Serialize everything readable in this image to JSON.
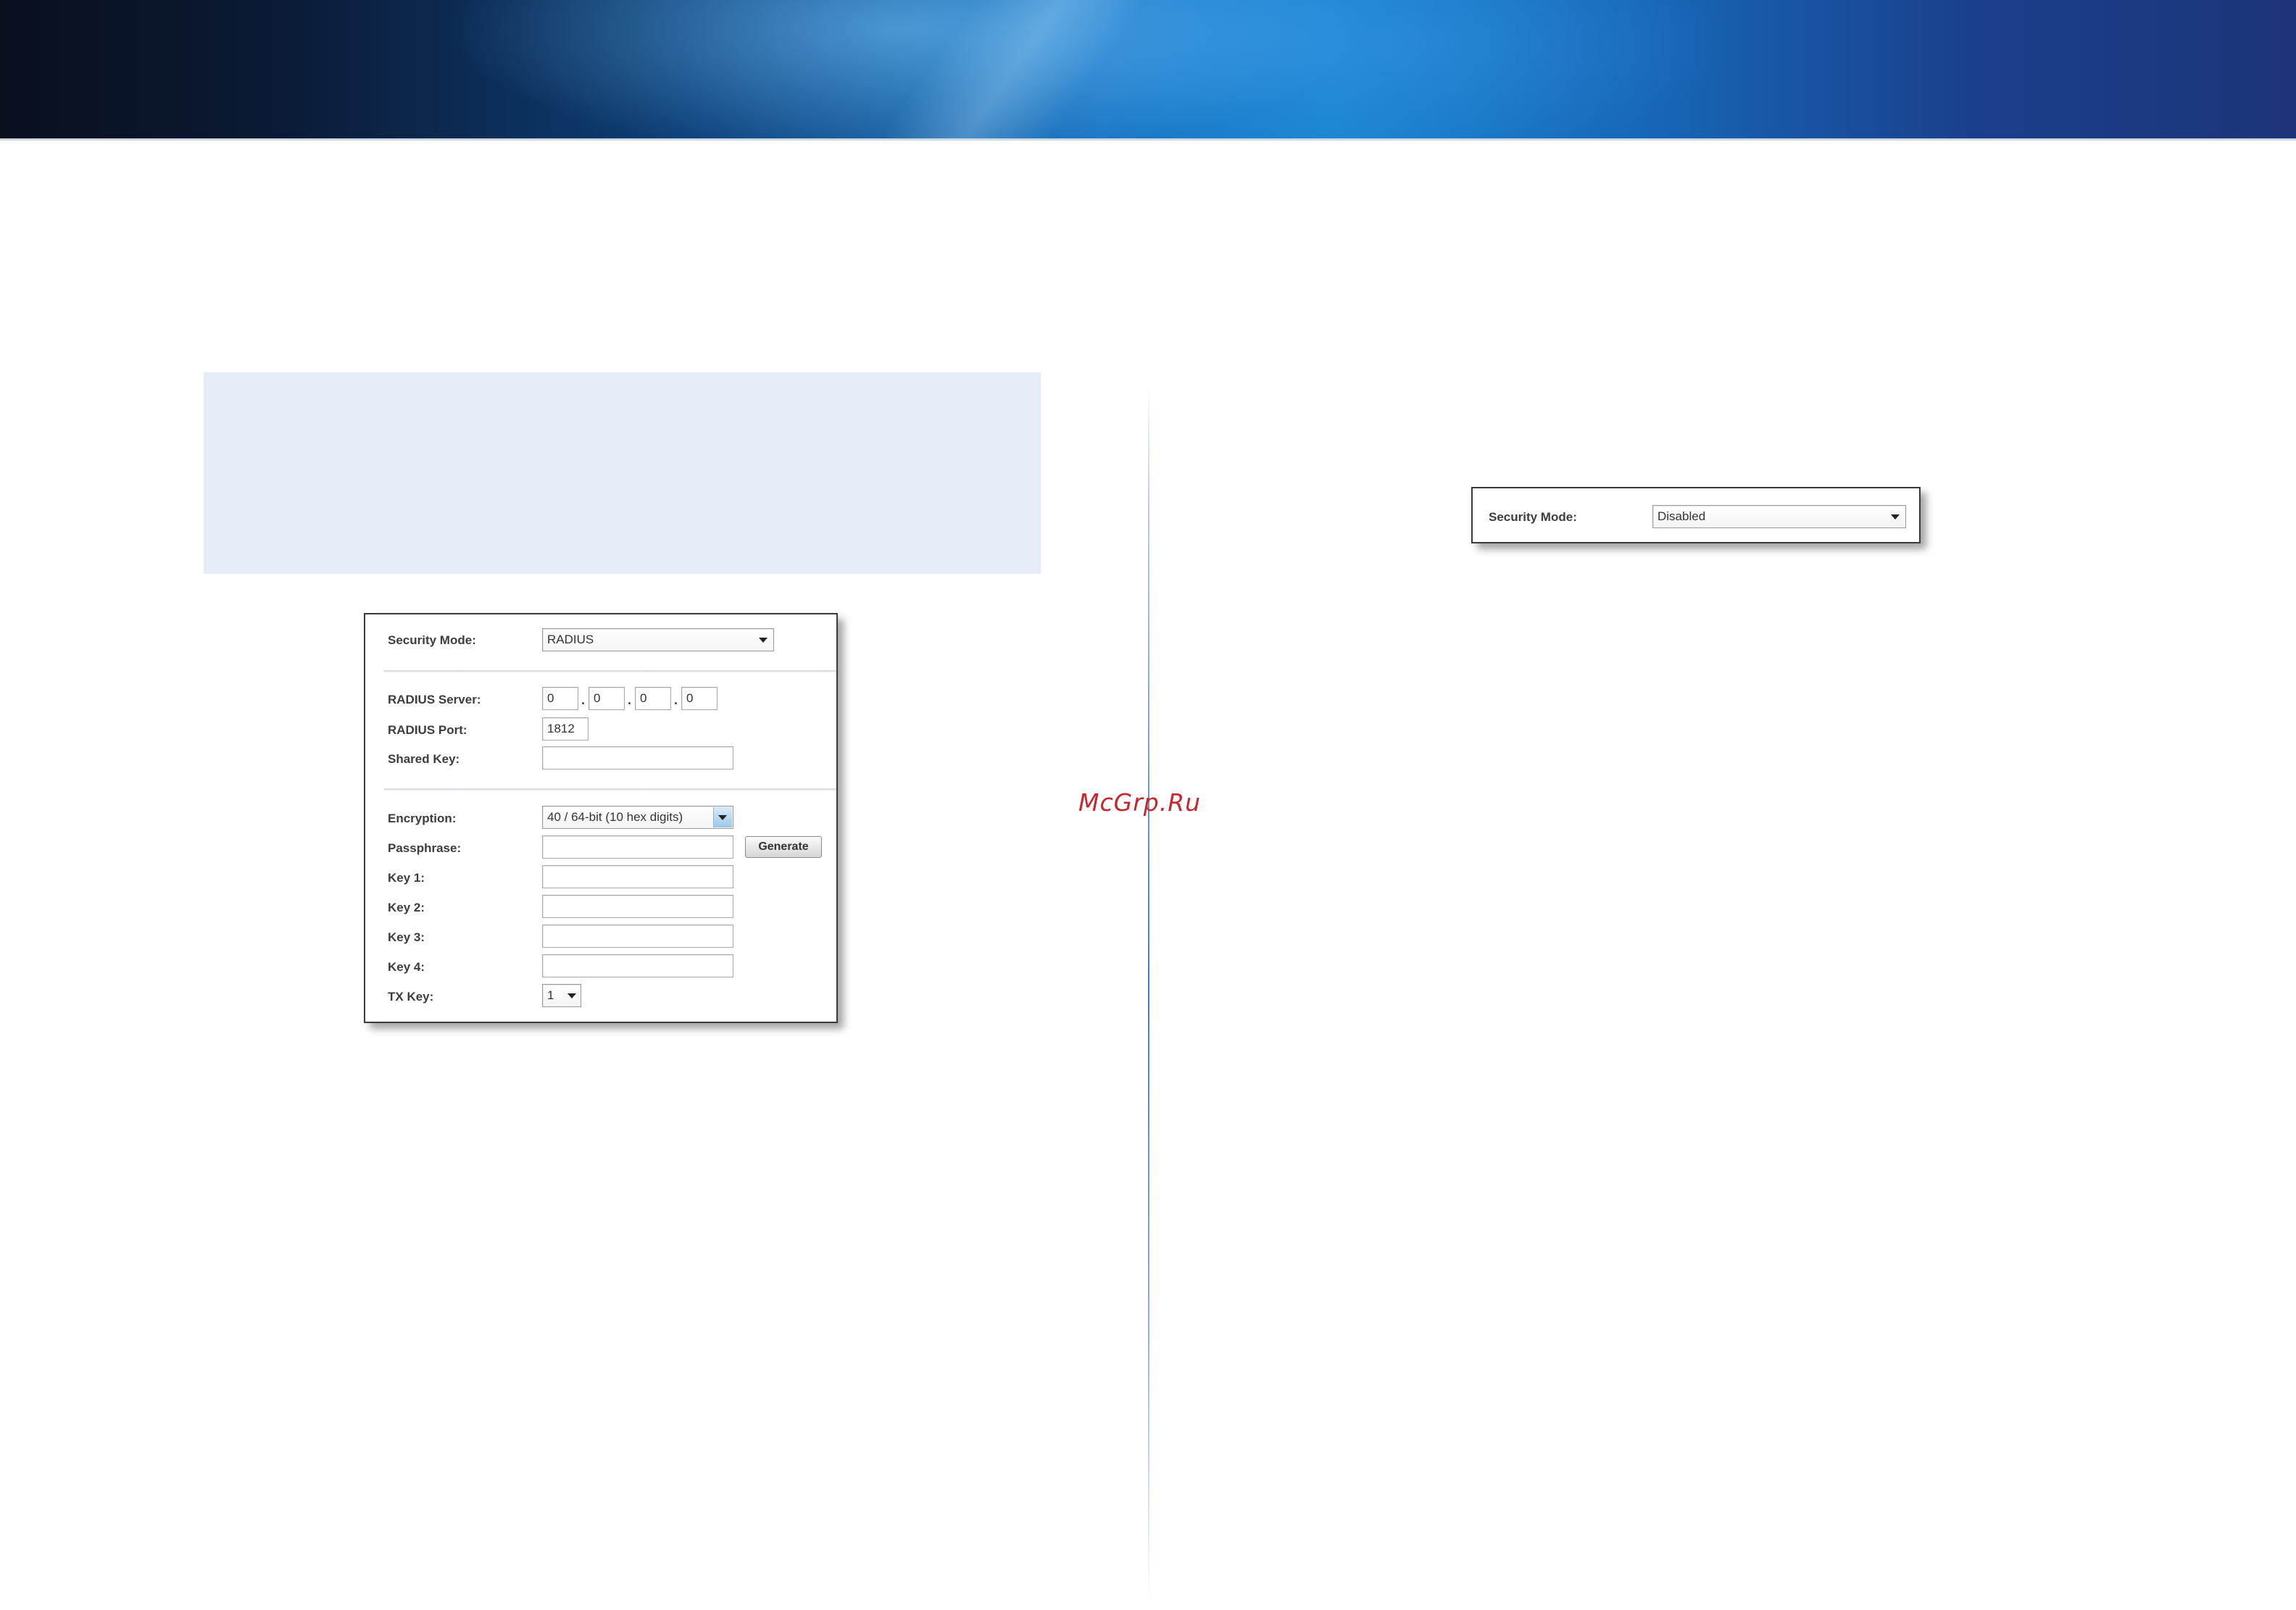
{
  "radius_panel": {
    "security_mode_label": "Security Mode:",
    "security_mode_value": "RADIUS",
    "radius_server_label": "RADIUS Server:",
    "radius_server_octets": [
      "0",
      "0",
      "0",
      "0"
    ],
    "ip_separator": ".",
    "radius_port_label": "RADIUS Port:",
    "radius_port_value": "1812",
    "shared_key_label": "Shared Key:",
    "shared_key_value": "",
    "encryption_label": "Encryption:",
    "encryption_value": "40 / 64-bit (10 hex digits)",
    "passphrase_label": "Passphrase:",
    "passphrase_value": "",
    "generate_button": "Generate",
    "key1_label": "Key 1:",
    "key2_label": "Key 2:",
    "key3_label": "Key 3:",
    "key4_label": "Key 4:",
    "tx_key_label": "TX Key:",
    "tx_key_value": "1"
  },
  "disabled_panel": {
    "security_mode_label": "Security Mode:",
    "security_mode_value": "Disabled"
  },
  "watermark": "McGrp.Ru",
  "colors": {
    "note_box": "#e7edf8",
    "divider": "#3e7ac6",
    "watermark": "#c8262d"
  }
}
